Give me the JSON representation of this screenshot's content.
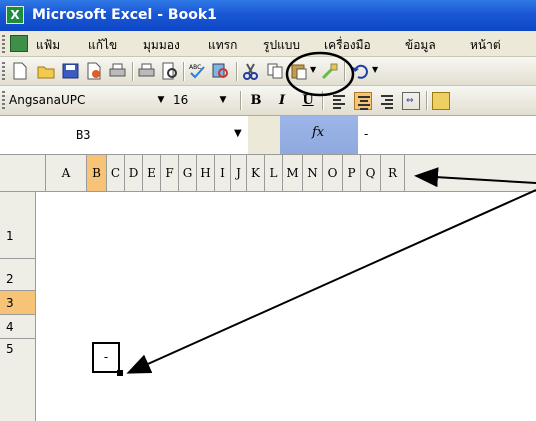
{
  "window": {
    "title": "Microsoft Excel - Book1"
  },
  "menu": {
    "items": [
      "แฟ้ม",
      "แก้ไข",
      "มุมมอง",
      "แทรก",
      "รูปแบบ",
      "เครื่องมือ",
      "ข้อมูล",
      "หน้าต่"
    ]
  },
  "toolbar": {
    "icons": [
      "new-icon",
      "open-icon",
      "save-icon",
      "permission-icon",
      "print-icon",
      "print-preview-icon",
      "spelling-icon",
      "research-icon",
      "cut-icon",
      "copy-icon",
      "paste-icon",
      "format-painter-icon",
      "undo-icon"
    ]
  },
  "formatting": {
    "font_name": "AngsanaUPC",
    "font_size": "16",
    "bold": "B",
    "italic": "I",
    "underline": "U",
    "center_selected": true
  },
  "formula_bar": {
    "name_box": "B3",
    "fx_label": "fx",
    "value": "-"
  },
  "grid": {
    "columns": [
      "A",
      "B",
      "C",
      "D",
      "E",
      "F",
      "G",
      "H",
      "I",
      "J",
      "K",
      "L",
      "M",
      "N",
      "O",
      "P",
      "Q",
      "R"
    ],
    "active_column": "B",
    "rows": [
      "1",
      "2",
      "3",
      "4",
      "5"
    ],
    "active_row": "3",
    "active_cell": "B3",
    "active_cell_value": "-"
  },
  "colors": {
    "titlebar": "#1a57d4",
    "header_highlight": "#f7c376",
    "fx_box": "#9db5e8"
  }
}
